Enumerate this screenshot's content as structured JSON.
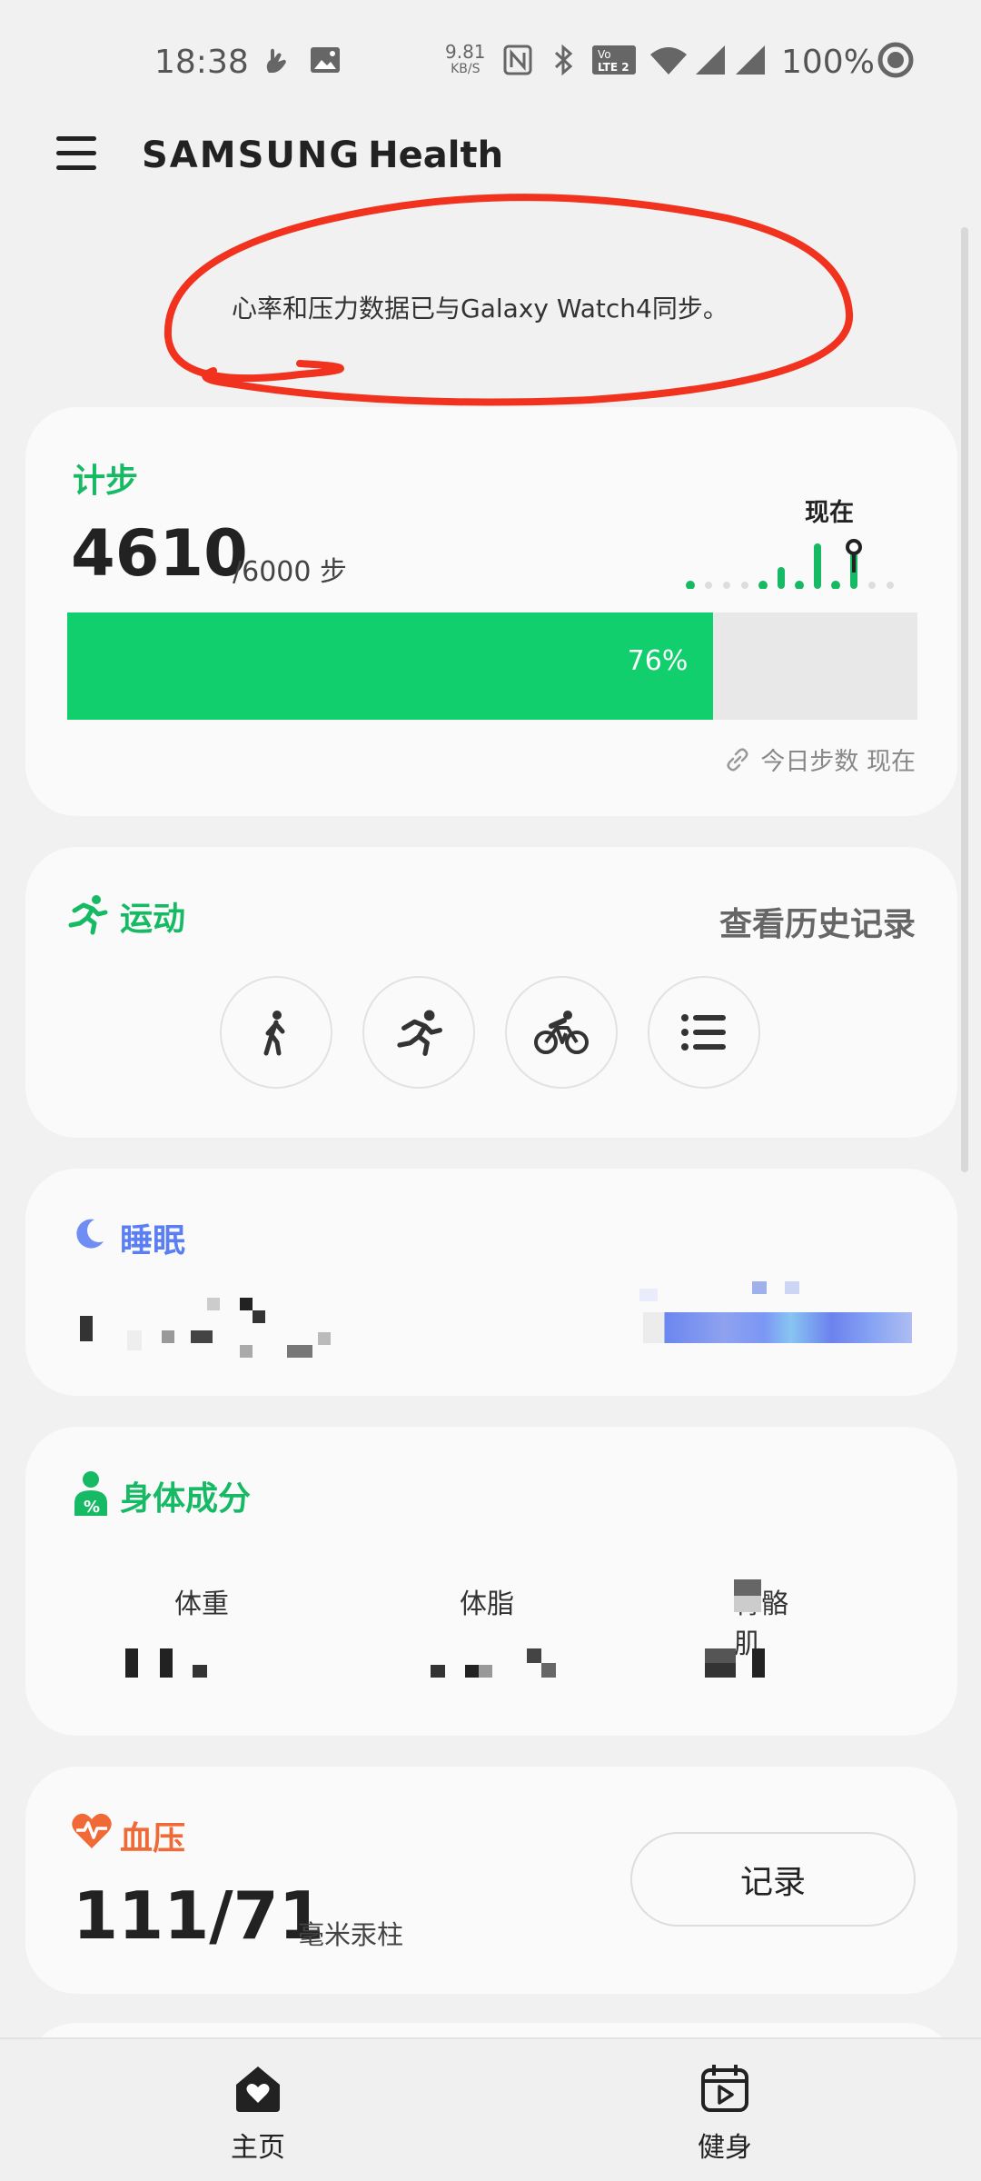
{
  "status_bar": {
    "time": "18:38",
    "net_speed_value": "9.81",
    "net_speed_unit": "KB/S",
    "lte_top": "Vo",
    "lte_top2": "1",
    "lte_bottom": "LTE 2",
    "battery": "100%"
  },
  "header": {
    "brand_samsung": "SAMSUNG",
    "brand_health": "Health"
  },
  "sync_message": "心率和压力数据已与Galaxy Watch4同步。",
  "steps": {
    "title": "计步",
    "value": "4610",
    "goal": "/6000 步",
    "now_label": "现在",
    "progress_pct": 76,
    "progress_label": "76%",
    "footer": "今日步数 现在"
  },
  "exercise": {
    "title": "运动",
    "history": "查看历史记录",
    "buttons": [
      "walk-icon",
      "run-icon",
      "cycling-icon",
      "list-icon"
    ]
  },
  "sleep": {
    "title": "睡眠"
  },
  "body_composition": {
    "title": "身体成分",
    "labels": [
      "体重",
      "体脂",
      "骨骼肌"
    ]
  },
  "blood_pressure": {
    "title": "血压",
    "value": "111/71",
    "unit": "毫米汞柱",
    "record_label": "记录"
  },
  "bottom_nav": {
    "home": "主页",
    "fitness": "健身"
  },
  "colors": {
    "green": "#16b964",
    "progress": "#12cf6d",
    "sleep": "#5b7ef2",
    "bp": "#f06a38",
    "annotation": "#f0321e"
  }
}
